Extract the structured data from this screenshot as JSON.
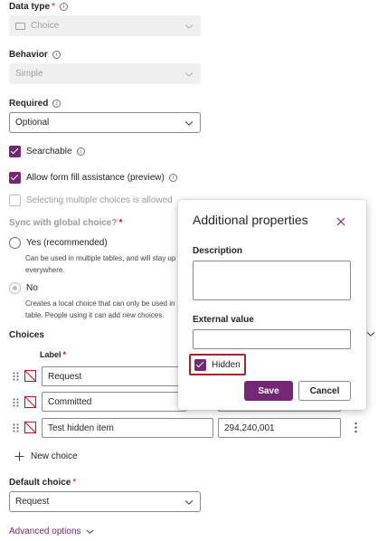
{
  "form": {
    "data_type": {
      "label": "Data type",
      "required_mark": "*",
      "value": "Choice"
    },
    "behavior": {
      "label": "Behavior",
      "value": "Simple"
    },
    "required": {
      "label": "Required",
      "value": "Optional"
    },
    "searchable": {
      "label": "Searchable",
      "checked": true
    },
    "form_fill": {
      "label": "Allow form fill assistance (preview)",
      "checked": true
    },
    "multiple": {
      "label": "Selecting multiple choices is allowed",
      "checked": false
    },
    "sync": {
      "label": "Sync with global choice?",
      "required_mark": "*",
      "yes_label": "Yes (recommended)",
      "yes_desc_line1": "Can be used in multiple tables, and will stay up",
      "yes_desc_line2": "everywhere.",
      "no_label": "No",
      "no_desc_line1": "Creates a local choice that can only be used in",
      "no_desc_line2": "table. People using it can add new choices."
    },
    "choices": {
      "title": "Choices",
      "label_header": "Label",
      "required_mark": "*",
      "items": [
        {
          "label": "Request",
          "value": ""
        },
        {
          "label": "Committed",
          "value": ""
        },
        {
          "label": "Test hidden item",
          "value": "294,240,001"
        }
      ],
      "new_choice_label": "New choice"
    },
    "default_choice": {
      "label": "Default choice",
      "required_mark": "*",
      "value": "Request"
    },
    "advanced_options": "Advanced options"
  },
  "panel": {
    "title": "Additional properties",
    "description_label": "Description",
    "description_value": "",
    "external_value_label": "External value",
    "external_value": "",
    "hidden_label": "Hidden",
    "hidden_checked": true,
    "save_label": "Save",
    "cancel_label": "Cancel"
  },
  "colors": {
    "accent": "#742774",
    "required": "#c50f1f",
    "highlight_border": "#a4262c"
  },
  "icons": [
    "info-icon",
    "chevron-down-icon",
    "choice-type-icon",
    "drag-handle-icon",
    "no-image-icon",
    "plus-icon",
    "more-icon",
    "close-icon",
    "checkmark-icon"
  ]
}
